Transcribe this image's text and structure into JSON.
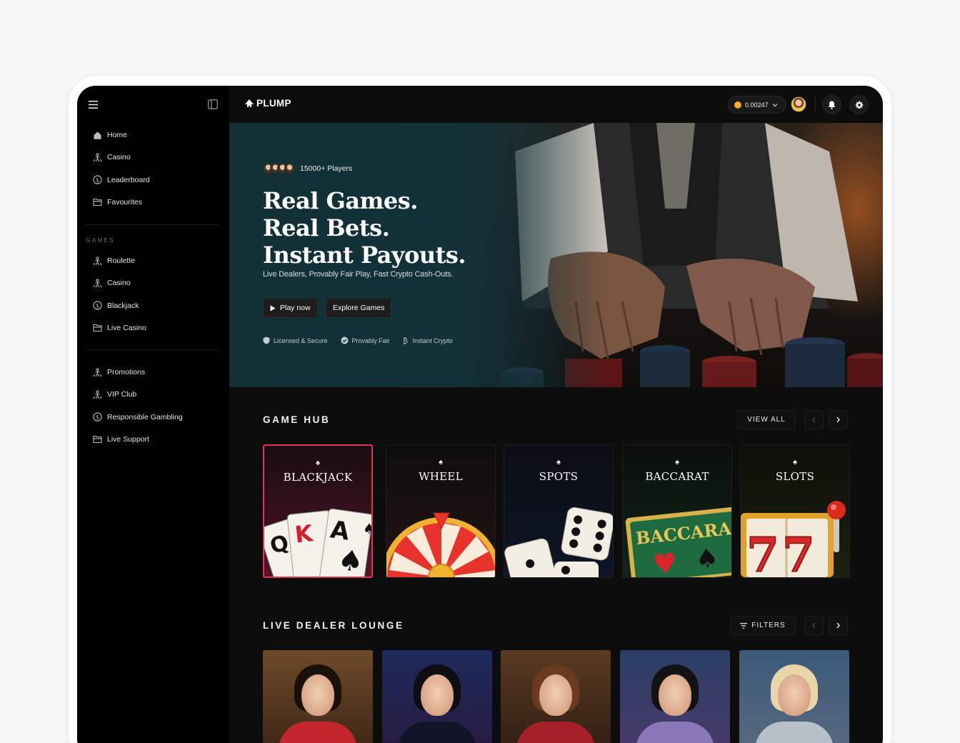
{
  "sidebar": {
    "top_items": [
      {
        "label": "Home",
        "icon": "home-icon"
      },
      {
        "label": "Casino",
        "icon": "person-icon"
      },
      {
        "label": "Leaderboard",
        "icon": "coin-icon"
      },
      {
        "label": "Favourites",
        "icon": "folder-icon"
      }
    ],
    "games_label": "GAMES",
    "game_items": [
      {
        "label": "Roulette",
        "icon": "person-icon"
      },
      {
        "label": "Casino",
        "icon": "person-icon"
      },
      {
        "label": "Blackjack",
        "icon": "coin-icon"
      },
      {
        "label": "Live Casino",
        "icon": "folder-icon"
      }
    ],
    "more_items": [
      {
        "label": "Promotions",
        "icon": "person-icon"
      },
      {
        "label": "VIP Club",
        "icon": "person-icon"
      },
      {
        "label": "Responsible Gambling",
        "icon": "coin-icon"
      },
      {
        "label": "Live Support",
        "icon": "folder-icon"
      }
    ]
  },
  "topbar": {
    "logo": "PLUMP",
    "balance": "0.00247"
  },
  "hero": {
    "players": "15000+ Players",
    "title_lines": [
      "Real Games.",
      "Real Bets.",
      "Instant Payouts."
    ],
    "subtitle": "Live Dealers, Provably Fair Play, Fast Crypto Cash-Outs.",
    "play_button": "Play now",
    "explore_button": "Explore Games",
    "trust": [
      "Licensed & Secure",
      "Provably Fair",
      "Instant Crypto"
    ]
  },
  "game_hub": {
    "title": "GAME HUB",
    "view_all": "VIEW ALL",
    "cards": [
      {
        "label": "BLACKJACK",
        "selected": true
      },
      {
        "label": "WHEEL"
      },
      {
        "label": "SPOTS"
      },
      {
        "label": "BACCARAT",
        "art_text": "BACCARA"
      },
      {
        "label": "SLOTS",
        "art_text": "77"
      }
    ]
  },
  "live_dealer": {
    "title": "LIVE DEALER LOUNGE",
    "filters": "FILTERS"
  },
  "colors": {
    "accent": "#e0355c",
    "hero_bg": "#133138",
    "sidebar_bg": "#000000",
    "coin": "#f4a21b"
  }
}
